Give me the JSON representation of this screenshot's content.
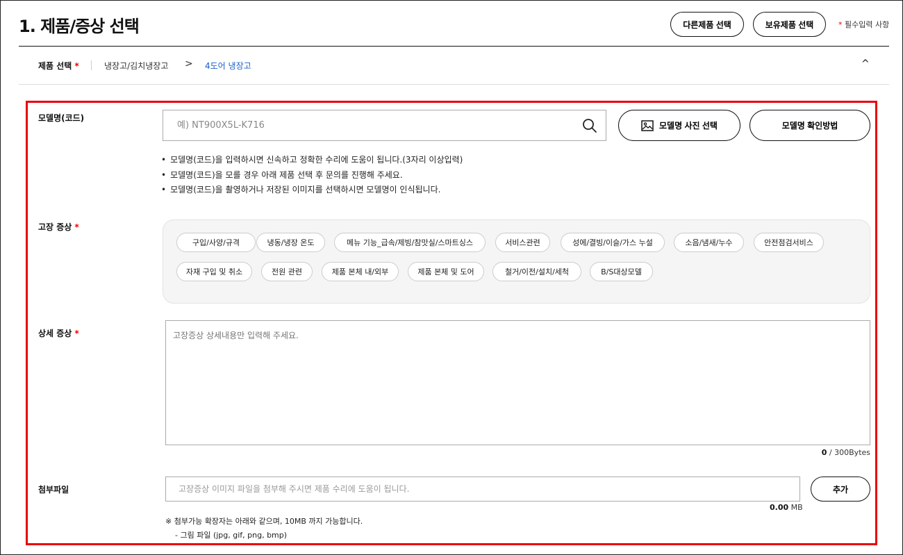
{
  "header": {
    "title": "1. 제품/증상 선택",
    "other_product_label": "다른제품 선택",
    "owned_product_label": "보유제품 선택",
    "required_star": "*",
    "required_note": "필수입력 사항"
  },
  "breadcrumb": {
    "label": "제품 선택",
    "star": "*",
    "category": "냉장고/김치냉장고",
    "arrow": ">",
    "current": "4도어 냉장고",
    "collapse": "^"
  },
  "model": {
    "label": "모델명(코드)",
    "placeholder": "예) NT900X5L-K716",
    "photo_button": "모델명 사진 선택",
    "howto_button": "모델명 확인방법",
    "notes": [
      "모델명(코드)을 입력하시면 신속하고 정확한 수리에 도움이 됩니다.(3자리 이상입력)",
      "모델명(코드)을 모를 경우 아래 제품 선택 후 문의를 진행해 주세요.",
      "모델명(코드)을 촬영하거나 저장된 이미지를 선택하시면 모델명이 인식됩니다."
    ]
  },
  "symptom": {
    "label": "고장 증상",
    "star": "*",
    "chips": [
      "구입/사양/규격",
      "냉동/냉장 온도",
      "메뉴 기능_급속/제빙/참맛실/스마트싱스",
      "서비스관련",
      "성에/결빙/이슬/가스 누설",
      "소음/냄새/누수",
      "안전점검서비스",
      "자재 구입 및 취소",
      "전원 관련",
      "제품 본체 내/외부",
      "제품 본체 및 도어",
      "철거/이전/설치/세척",
      "B/S대상모델"
    ]
  },
  "detail": {
    "label": "상세 증상",
    "star": "*",
    "placeholder": "고장증상 상세내용만 입력해 주세요.",
    "count": "0",
    "limit": " / 300Bytes"
  },
  "attachment": {
    "label": "첨부파일",
    "placeholder": "고장증상 이미지 파일을 첨부해 주시면 제품 수리에 도움이 됩니다.",
    "add_button": "추가",
    "size_value": "0.00",
    "size_unit": " MB",
    "note1": "※ 첨부가능 확장자는 아래와 같으며, 10MB 까지 가능합니다.",
    "note2": "- 그림 파일 (jpg, gif, png, bmp)"
  }
}
